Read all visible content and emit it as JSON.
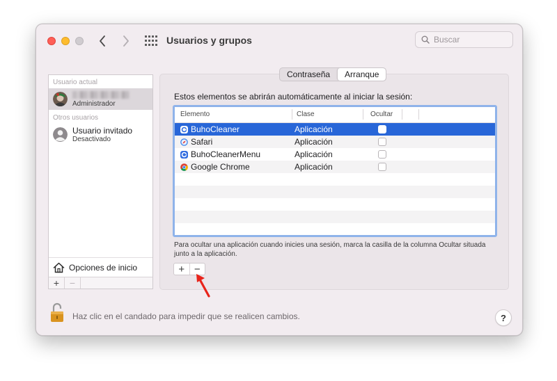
{
  "window": {
    "title": "Usuarios y grupos",
    "search_placeholder": "Buscar"
  },
  "sidebar": {
    "current_user_label": "Usuario actual",
    "current_user_role": "Administrador",
    "other_users_label": "Otros usuarios",
    "guest_name": "Usuario invitado",
    "guest_status": "Desactivado",
    "login_options_label": "Opciones de inicio",
    "add_symbol": "+",
    "remove_symbol": "−"
  },
  "tabs": [
    {
      "label": "Contraseña",
      "selected": false
    },
    {
      "label": "Arranque",
      "selected": true
    }
  ],
  "login_items": {
    "heading": "Estos elementos se abrirán automáticamente al iniciar la sesión:",
    "columns": [
      "Elemento",
      "Clase",
      "Ocultar"
    ],
    "rows": [
      {
        "name": "BuhoCleaner",
        "class": "Aplicación",
        "hidden": false,
        "icon": "buhocleaner-icon",
        "selected": true
      },
      {
        "name": "Safari",
        "class": "Aplicación",
        "hidden": false,
        "icon": "safari-icon",
        "selected": false
      },
      {
        "name": "BuhoCleanerMenu",
        "class": "Aplicación",
        "hidden": false,
        "icon": "buhocleaner-menu-icon",
        "selected": false
      },
      {
        "name": "Google Chrome",
        "class": "Aplicación",
        "hidden": false,
        "icon": "chrome-icon",
        "selected": false
      }
    ],
    "info": "Para ocultar una aplicación cuando inicies una sesión, marca la casilla de la columna Ocultar situada junto a la aplicación.",
    "add_symbol": "+",
    "remove_symbol": "−"
  },
  "footer": {
    "lock_text": "Haz clic en el candado para impedir que se realicen cambios.",
    "help_symbol": "?"
  },
  "colors": {
    "selection": "#2866d8",
    "table_focus_ring": "#8fb3ea",
    "annotation_arrow": "#e8231a"
  }
}
